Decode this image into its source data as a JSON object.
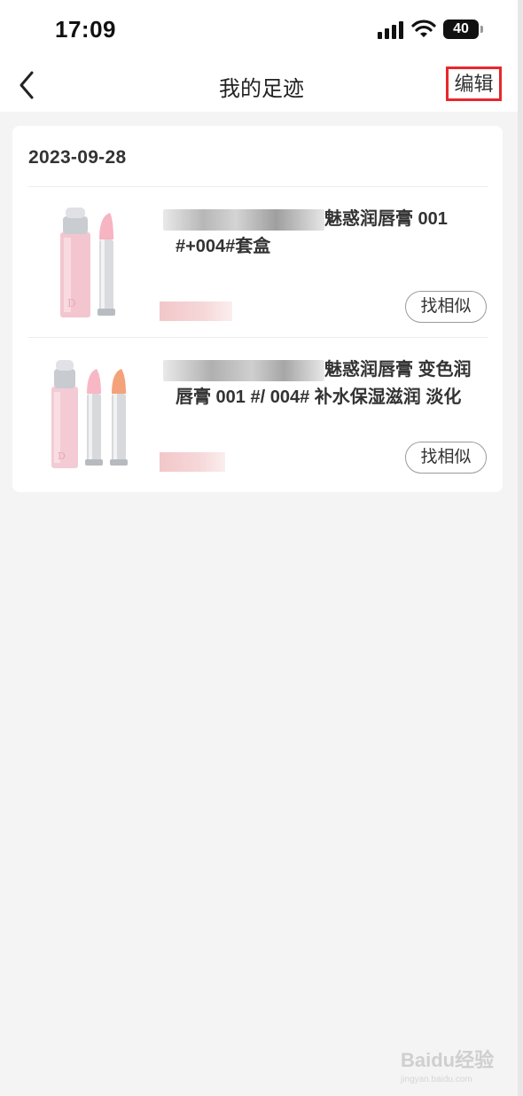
{
  "status_bar": {
    "time": "17:09",
    "battery": "40"
  },
  "nav": {
    "title": "我的足迹",
    "edit_label": "编辑"
  },
  "history": {
    "date": "2023-09-28",
    "items": [
      {
        "title_visible": "魅惑润唇膏 001 #+004#套盒",
        "line1": "魅惑润唇膏 001",
        "line2": "#+004#套盒",
        "similar_label": "找相似"
      },
      {
        "title_visible": "魅惑润唇膏 变色润唇膏 001 #/ 004# 补水保湿滋润 淡化",
        "line1": "魅惑润唇膏 变色润",
        "line2": "唇膏  001 #/ 004# 补水保湿滋润 淡化",
        "similar_label": "找相似"
      }
    ]
  },
  "watermark": {
    "brand": "Baidu经验",
    "url": "jingyan.baidu.com"
  },
  "colors": {
    "highlight": "#e8272b",
    "background": "#f4f4f4",
    "card": "#ffffff"
  }
}
